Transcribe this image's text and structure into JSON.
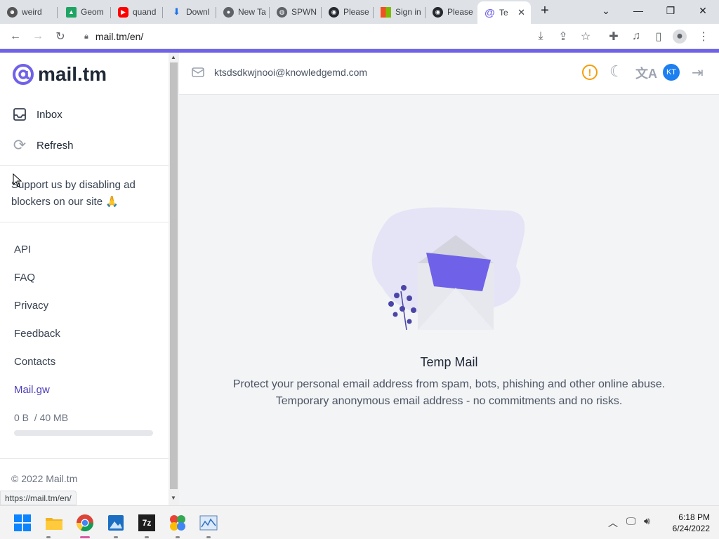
{
  "browser": {
    "tabs": [
      {
        "label": "weird",
        "icon": "face-icon",
        "color": "#555"
      },
      {
        "label": "Geom",
        "icon": "drive-icon",
        "color": "#1fa463"
      },
      {
        "label": "quand",
        "icon": "youtube-icon",
        "color": "#ff0000"
      },
      {
        "label": "Downl",
        "icon": "download-icon",
        "color": "#1a73e8"
      },
      {
        "label": "New Ta",
        "icon": "chrome-icon",
        "color": "#5f6368"
      },
      {
        "label": "SPWN",
        "icon": "globe-icon",
        "color": "#5f6368"
      },
      {
        "label": "Please",
        "icon": "github-icon",
        "color": "#24292f"
      },
      {
        "label": "Sign in",
        "icon": "microsoft-icon",
        "color": "#f25022"
      },
      {
        "label": "Please",
        "icon": "github-icon",
        "color": "#24292f"
      },
      {
        "label": "Te",
        "icon": "mailtm-icon",
        "color": "#6f62e8"
      }
    ],
    "url": "mail.tm/en/",
    "status_url": "https://mail.tm/en/"
  },
  "app": {
    "logo_text": "mail.tm",
    "email": "ktsdsdkwjnooi@knowledgemd.com",
    "avatar_initials": "KT",
    "nav": {
      "inbox": "Inbox",
      "refresh": "Refresh"
    },
    "support_text": "Support us by disabling ad blockers on our site 🙏",
    "links": {
      "api": "API",
      "faq": "FAQ",
      "privacy": "Privacy",
      "feedback": "Feedback",
      "contacts": "Contacts",
      "mailgw": "Mail.gw"
    },
    "storage": {
      "used": "0 B",
      "total": "/ 40 MB",
      "fraction": 0
    },
    "footer": "© 2022 Mail.tm",
    "empty": {
      "title": "Temp Mail",
      "line1": "Protect your personal email address from spam, bots, phishing and other online abuse.",
      "line2": "Temporary anonymous email address - no commitments and no risks."
    },
    "accent": "#6f62e8"
  },
  "system": {
    "time": "6:18 PM",
    "date": "6/24/2022"
  }
}
